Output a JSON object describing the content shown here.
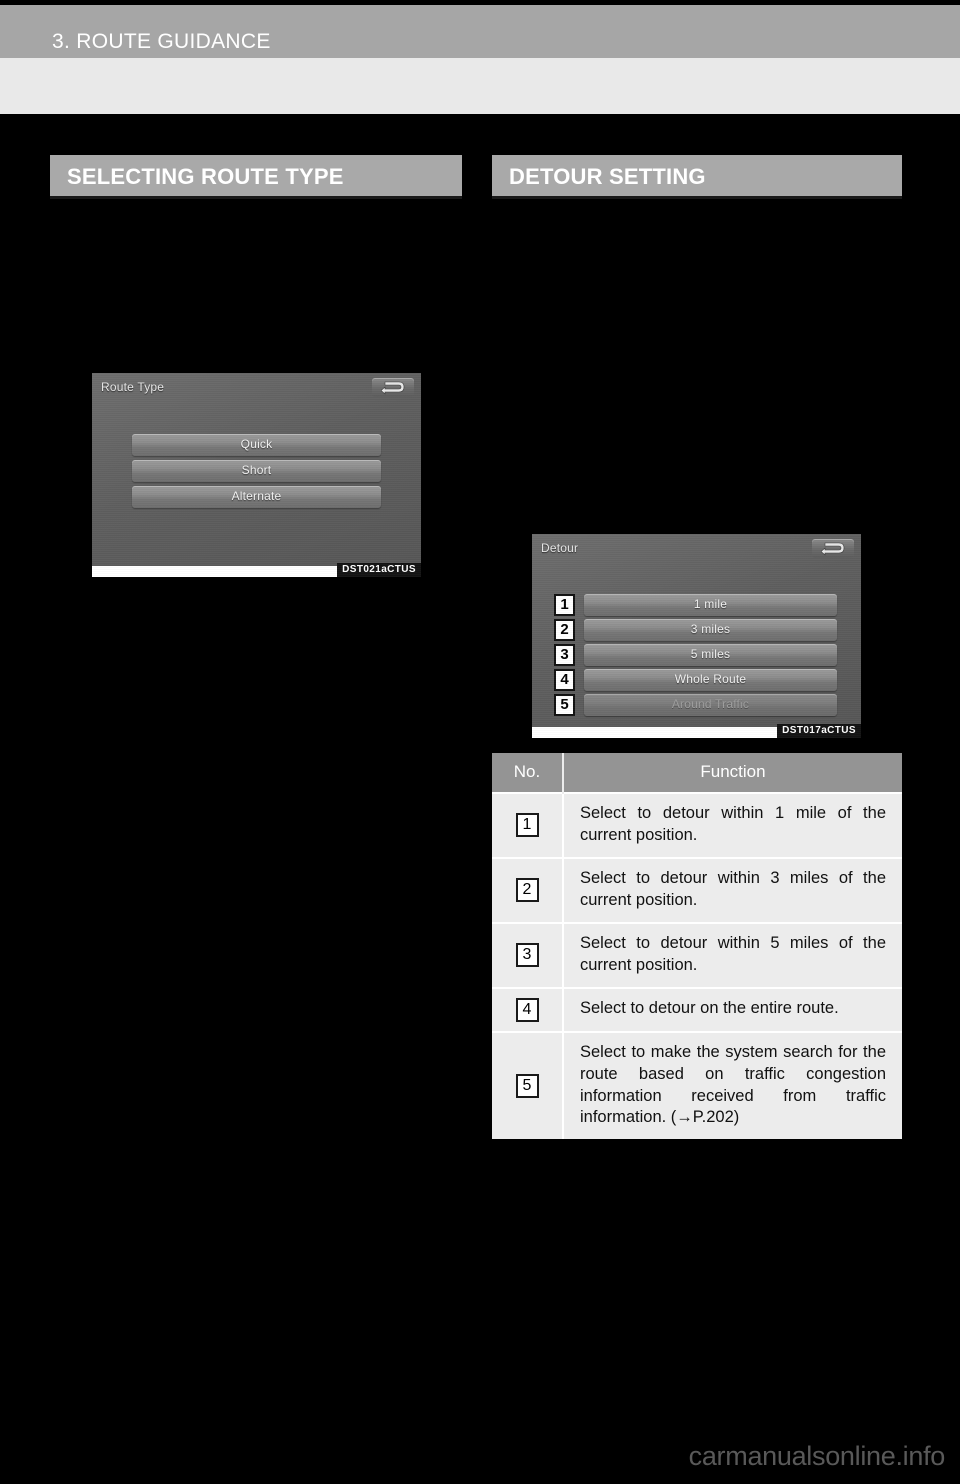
{
  "page": {
    "chapter_title": "3. ROUTE GUIDANCE",
    "watermark": "carmanualsonline.info"
  },
  "sections": [
    {
      "title": "SELECTING ROUTE TYPE"
    },
    {
      "title": "DETOUR SETTING"
    }
  ],
  "route_type_screen": {
    "title": "Route Type",
    "back_icon": "back-arrow-icon",
    "caption": "DST021aCTUS",
    "buttons": [
      {
        "label": "Quick",
        "disabled": false
      },
      {
        "label": "Short",
        "disabled": false
      },
      {
        "label": "Alternate",
        "disabled": false
      }
    ]
  },
  "detour_screen": {
    "title": "Detour",
    "back_icon": "back-arrow-icon",
    "caption": "DST017aCTUS",
    "buttons": [
      {
        "num": "1",
        "label": "1 mile",
        "disabled": false
      },
      {
        "num": "2",
        "label": "3 miles",
        "disabled": false
      },
      {
        "num": "3",
        "label": "5 miles",
        "disabled": false
      },
      {
        "num": "4",
        "label": "Whole Route",
        "disabled": false
      },
      {
        "num": "5",
        "label": "Around Traffic",
        "disabled": true
      }
    ]
  },
  "function_table": {
    "headers": {
      "no": "No.",
      "function": "Function"
    },
    "rows": [
      {
        "no": "1",
        "function": "Select to detour within 1 mile of the current position."
      },
      {
        "no": "2",
        "function": "Select to detour within 3 miles of the current position."
      },
      {
        "no": "3",
        "function": "Select to detour within 5 miles of the current position."
      },
      {
        "no": "4",
        "function": "Select to detour on the entire route."
      },
      {
        "no": "5",
        "function": "Select to make the system search for the route based on traffic congestion information received from traffic information. (→P.202)"
      }
    ]
  }
}
